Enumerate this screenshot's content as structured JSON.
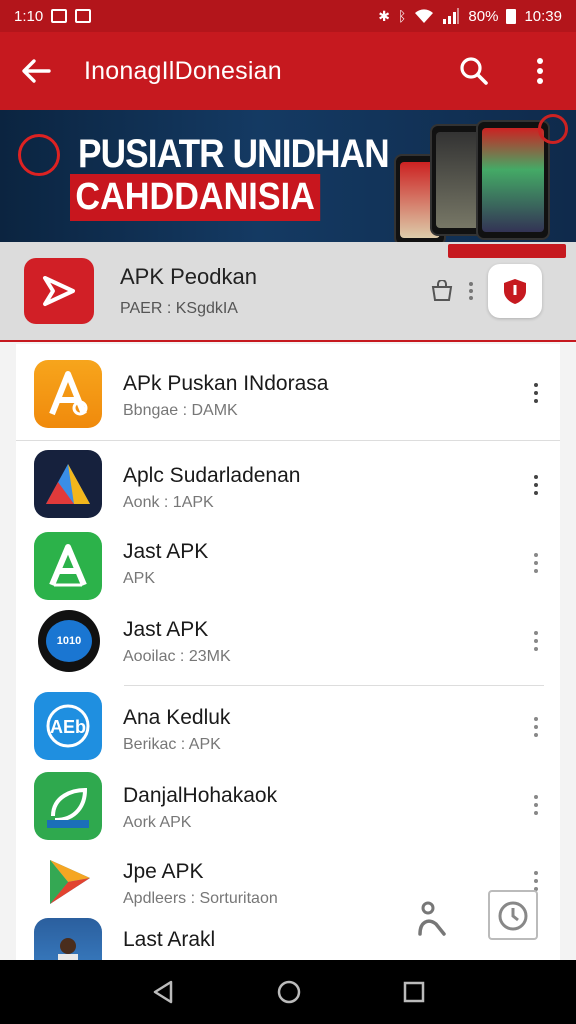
{
  "status_bar": {
    "time": "1:10",
    "battery": "80%",
    "clock_right": "10:39"
  },
  "app_bar": {
    "title": "InonagIlDonesian",
    "back_icon": "back-arrow-icon",
    "search_icon": "search-icon",
    "menu_icon": "more-vert-icon"
  },
  "banner": {
    "line1": "PUSIATR UNIDHAN",
    "line2": "CAHDDANISIA"
  },
  "featured": {
    "title": "APK Peodkan",
    "subtitle": "PAER : KSgdkIA",
    "badge": "",
    "colors": {
      "icon_bg": "#d11f26",
      "accent": "#c6191f"
    }
  },
  "apps": [
    {
      "title": "APk Puskan INdorasa",
      "subtitle": "Bbngae : DAMK",
      "icon": "orange-a-icon"
    },
    {
      "title": "Aplc Sudarladenan",
      "subtitle": "Aonk :   1APK",
      "icon": "blue-a-icon"
    },
    {
      "title": "Jast APK",
      "subtitle": "APK",
      "icon": "green-a-icon"
    },
    {
      "title": "Jast APK",
      "subtitle": "Aooilac : 23MK",
      "icon": "black-badge-icon"
    },
    {
      "title": "Ana Kedluk",
      "subtitle": "Berikac :  APK",
      "icon": "blue-ab-icon"
    },
    {
      "title": "DanjalHohakaok",
      "subtitle": "Aork APK",
      "icon": "green-leaf-icon"
    },
    {
      "title": "Jpe APK",
      "subtitle": "Apdleers : Sorturitaon",
      "icon": "play-triangle-icon"
    },
    {
      "title": "Last Arakl",
      "subtitle": "",
      "icon": "photo-icon"
    }
  ],
  "nav_bar": {
    "back": "nav-back-icon",
    "home": "nav-home-icon",
    "recents": "nav-recents-icon"
  }
}
